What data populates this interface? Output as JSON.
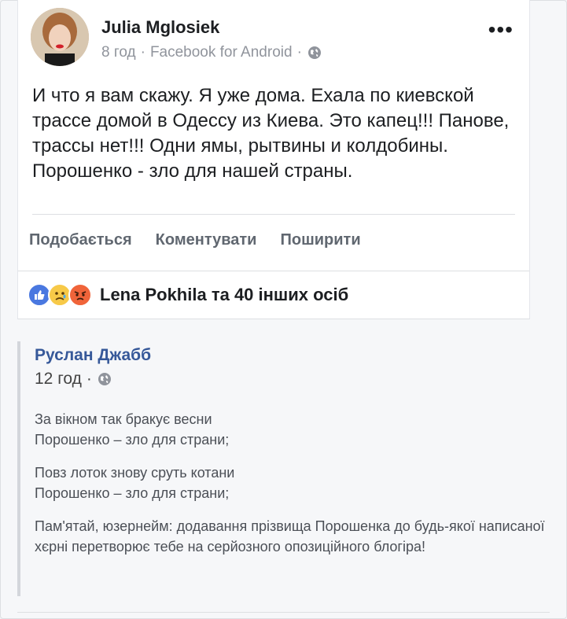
{
  "post": {
    "author": "Julia Mglosiek",
    "time": "8 год",
    "source": "Facebook for Android",
    "more_label": "•••",
    "text": "И что я вам скажу. Я уже дома. Ехала по киевской трассе домой в Одессу из Киева. Это капец!!! Панове, трассы нет!!! Одни ямы, рытвины и колдобины. Порошенко - зло для нашей страны.",
    "privacy_icon": "globe-icon"
  },
  "actions": {
    "like": "Подобається",
    "comment": "Коментувати",
    "share": "Поширити"
  },
  "reactions": {
    "icons": [
      "like-icon",
      "sad-icon",
      "angry-icon"
    ],
    "summary": "Lena Pokhila та 40 інших осіб",
    "colors": {
      "like": "#4a78e0",
      "sad": "#f7c948",
      "angry": "#f0643a"
    }
  },
  "quoted": {
    "author": "Руслан Джабб",
    "time": "12 год",
    "privacy_icon": "globe-icon",
    "stanza1_line1": "За вікном так бракує весни",
    "stanza1_line2": "Порошенко – зло для страни;",
    "stanza2_line1": "Повз лоток знову сруть котани",
    "stanza2_line2": "Порошенко – зло для страни;",
    "stanza3": "Пам'ятай, юзернейм: додавання прізвища Порошенка до будь-якої написаної хєрні перетворює тебе на серйозного опозиційного блогіра!"
  },
  "colors": {
    "link": "#365899",
    "secondary": "#90949c",
    "text": "#1c1e21"
  }
}
